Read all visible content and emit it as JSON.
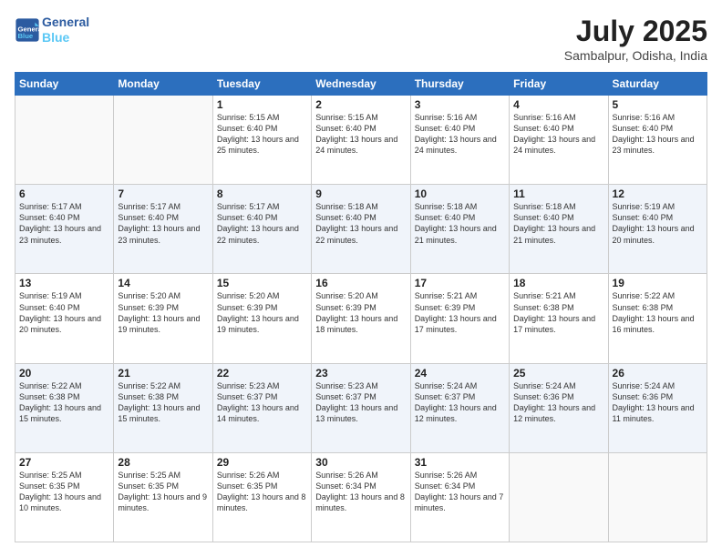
{
  "logo": {
    "line1": "General",
    "line2": "Blue"
  },
  "title": "July 2025",
  "subtitle": "Sambalpur, Odisha, India",
  "days_header": [
    "Sunday",
    "Monday",
    "Tuesday",
    "Wednesday",
    "Thursday",
    "Friday",
    "Saturday"
  ],
  "weeks": [
    [
      {
        "day": "",
        "info": ""
      },
      {
        "day": "",
        "info": ""
      },
      {
        "day": "1",
        "info": "Sunrise: 5:15 AM\nSunset: 6:40 PM\nDaylight: 13 hours and 25 minutes."
      },
      {
        "day": "2",
        "info": "Sunrise: 5:15 AM\nSunset: 6:40 PM\nDaylight: 13 hours and 24 minutes."
      },
      {
        "day": "3",
        "info": "Sunrise: 5:16 AM\nSunset: 6:40 PM\nDaylight: 13 hours and 24 minutes."
      },
      {
        "day": "4",
        "info": "Sunrise: 5:16 AM\nSunset: 6:40 PM\nDaylight: 13 hours and 24 minutes."
      },
      {
        "day": "5",
        "info": "Sunrise: 5:16 AM\nSunset: 6:40 PM\nDaylight: 13 hours and 23 minutes."
      }
    ],
    [
      {
        "day": "6",
        "info": "Sunrise: 5:17 AM\nSunset: 6:40 PM\nDaylight: 13 hours and 23 minutes."
      },
      {
        "day": "7",
        "info": "Sunrise: 5:17 AM\nSunset: 6:40 PM\nDaylight: 13 hours and 23 minutes."
      },
      {
        "day": "8",
        "info": "Sunrise: 5:17 AM\nSunset: 6:40 PM\nDaylight: 13 hours and 22 minutes."
      },
      {
        "day": "9",
        "info": "Sunrise: 5:18 AM\nSunset: 6:40 PM\nDaylight: 13 hours and 22 minutes."
      },
      {
        "day": "10",
        "info": "Sunrise: 5:18 AM\nSunset: 6:40 PM\nDaylight: 13 hours and 21 minutes."
      },
      {
        "day": "11",
        "info": "Sunrise: 5:18 AM\nSunset: 6:40 PM\nDaylight: 13 hours and 21 minutes."
      },
      {
        "day": "12",
        "info": "Sunrise: 5:19 AM\nSunset: 6:40 PM\nDaylight: 13 hours and 20 minutes."
      }
    ],
    [
      {
        "day": "13",
        "info": "Sunrise: 5:19 AM\nSunset: 6:40 PM\nDaylight: 13 hours and 20 minutes."
      },
      {
        "day": "14",
        "info": "Sunrise: 5:20 AM\nSunset: 6:39 PM\nDaylight: 13 hours and 19 minutes."
      },
      {
        "day": "15",
        "info": "Sunrise: 5:20 AM\nSunset: 6:39 PM\nDaylight: 13 hours and 19 minutes."
      },
      {
        "day": "16",
        "info": "Sunrise: 5:20 AM\nSunset: 6:39 PM\nDaylight: 13 hours and 18 minutes."
      },
      {
        "day": "17",
        "info": "Sunrise: 5:21 AM\nSunset: 6:39 PM\nDaylight: 13 hours and 17 minutes."
      },
      {
        "day": "18",
        "info": "Sunrise: 5:21 AM\nSunset: 6:38 PM\nDaylight: 13 hours and 17 minutes."
      },
      {
        "day": "19",
        "info": "Sunrise: 5:22 AM\nSunset: 6:38 PM\nDaylight: 13 hours and 16 minutes."
      }
    ],
    [
      {
        "day": "20",
        "info": "Sunrise: 5:22 AM\nSunset: 6:38 PM\nDaylight: 13 hours and 15 minutes."
      },
      {
        "day": "21",
        "info": "Sunrise: 5:22 AM\nSunset: 6:38 PM\nDaylight: 13 hours and 15 minutes."
      },
      {
        "day": "22",
        "info": "Sunrise: 5:23 AM\nSunset: 6:37 PM\nDaylight: 13 hours and 14 minutes."
      },
      {
        "day": "23",
        "info": "Sunrise: 5:23 AM\nSunset: 6:37 PM\nDaylight: 13 hours and 13 minutes."
      },
      {
        "day": "24",
        "info": "Sunrise: 5:24 AM\nSunset: 6:37 PM\nDaylight: 13 hours and 12 minutes."
      },
      {
        "day": "25",
        "info": "Sunrise: 5:24 AM\nSunset: 6:36 PM\nDaylight: 13 hours and 12 minutes."
      },
      {
        "day": "26",
        "info": "Sunrise: 5:24 AM\nSunset: 6:36 PM\nDaylight: 13 hours and 11 minutes."
      }
    ],
    [
      {
        "day": "27",
        "info": "Sunrise: 5:25 AM\nSunset: 6:35 PM\nDaylight: 13 hours and 10 minutes."
      },
      {
        "day": "28",
        "info": "Sunrise: 5:25 AM\nSunset: 6:35 PM\nDaylight: 13 hours and 9 minutes."
      },
      {
        "day": "29",
        "info": "Sunrise: 5:26 AM\nSunset: 6:35 PM\nDaylight: 13 hours and 8 minutes."
      },
      {
        "day": "30",
        "info": "Sunrise: 5:26 AM\nSunset: 6:34 PM\nDaylight: 13 hours and 8 minutes."
      },
      {
        "day": "31",
        "info": "Sunrise: 5:26 AM\nSunset: 6:34 PM\nDaylight: 13 hours and 7 minutes."
      },
      {
        "day": "",
        "info": ""
      },
      {
        "day": "",
        "info": ""
      }
    ]
  ]
}
